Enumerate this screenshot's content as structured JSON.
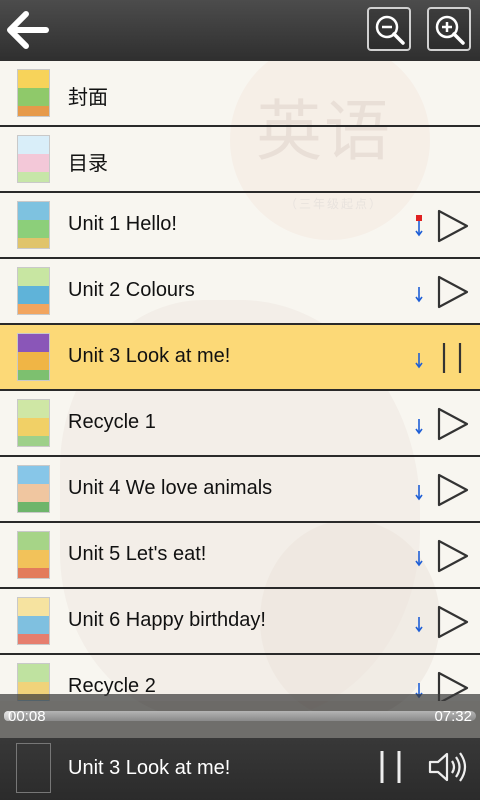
{
  "header": {
    "back_icon": "back-arrow-icon",
    "zoom_out_icon": "zoom-out-icon",
    "zoom_in_icon": "zoom-in-icon"
  },
  "background": {
    "cover_title": "英语",
    "cover_subtitle": "（三年级起点）"
  },
  "list": {
    "items": [
      {
        "label": "封面",
        "has_controls": false,
        "active": false,
        "thumb_colors": [
          "#f7d35a",
          "#8fc96a",
          "#e69a4a"
        ]
      },
      {
        "label": "目录",
        "has_controls": false,
        "active": false,
        "thumb_colors": [
          "#d9eef9",
          "#f3c8d8",
          "#c7e6a8"
        ]
      },
      {
        "label": "Unit 1 Hello!",
        "has_controls": true,
        "active": false,
        "download_state": "partial",
        "play_state": "play",
        "thumb_colors": [
          "#7ec2e0",
          "#8ccf7a",
          "#e0c46b"
        ]
      },
      {
        "label": "Unit 2 Colours",
        "has_controls": true,
        "active": false,
        "download_state": "available",
        "play_state": "play",
        "thumb_colors": [
          "#c8e6a2",
          "#5fb3d9",
          "#f2a55f"
        ]
      },
      {
        "label": "Unit 3 Look at me!",
        "has_controls": true,
        "active": true,
        "download_state": "available",
        "play_state": "pause",
        "thumb_colors": [
          "#8a56b8",
          "#f0b545",
          "#7dc06f"
        ]
      },
      {
        "label": "Recycle 1",
        "has_controls": true,
        "active": false,
        "download_state": "available",
        "play_state": "play",
        "thumb_colors": [
          "#cfe7a5",
          "#f1d066",
          "#9ed08a"
        ]
      },
      {
        "label": "Unit 4 We love animals",
        "has_controls": true,
        "active": false,
        "download_state": "available",
        "play_state": "play",
        "thumb_colors": [
          "#87c6e8",
          "#f0c6a0",
          "#6eb56b"
        ]
      },
      {
        "label": "Unit 5 Let's eat!",
        "has_controls": true,
        "active": false,
        "download_state": "available",
        "play_state": "play",
        "thumb_colors": [
          "#a6d487",
          "#f2c25a",
          "#e37b5b"
        ]
      },
      {
        "label": "Unit 6 Happy birthday!",
        "has_controls": true,
        "active": false,
        "download_state": "available",
        "play_state": "play",
        "thumb_colors": [
          "#f6e3a0",
          "#7fc0e0",
          "#e67e6e"
        ]
      },
      {
        "label": "Recycle 2",
        "has_controls": true,
        "active": false,
        "download_state": "available",
        "play_state": "play",
        "thumb_colors": [
          "#bfe2a0",
          "#f0d37a",
          "#8cc4e6"
        ]
      }
    ]
  },
  "player": {
    "current_time": "00:08",
    "total_time": "07:32",
    "progress": 0.018,
    "now_playing": "Unit 3 Look at me!",
    "thumb_colors": [
      "#8a56b8",
      "#f0b545",
      "#7dc06f"
    ],
    "pause_icon": "pause-icon",
    "volume_icon": "volume-icon"
  },
  "colors": {
    "active_row": "#fcd977",
    "download_blue": "#1f5fd6",
    "download_red": "#e02020"
  }
}
